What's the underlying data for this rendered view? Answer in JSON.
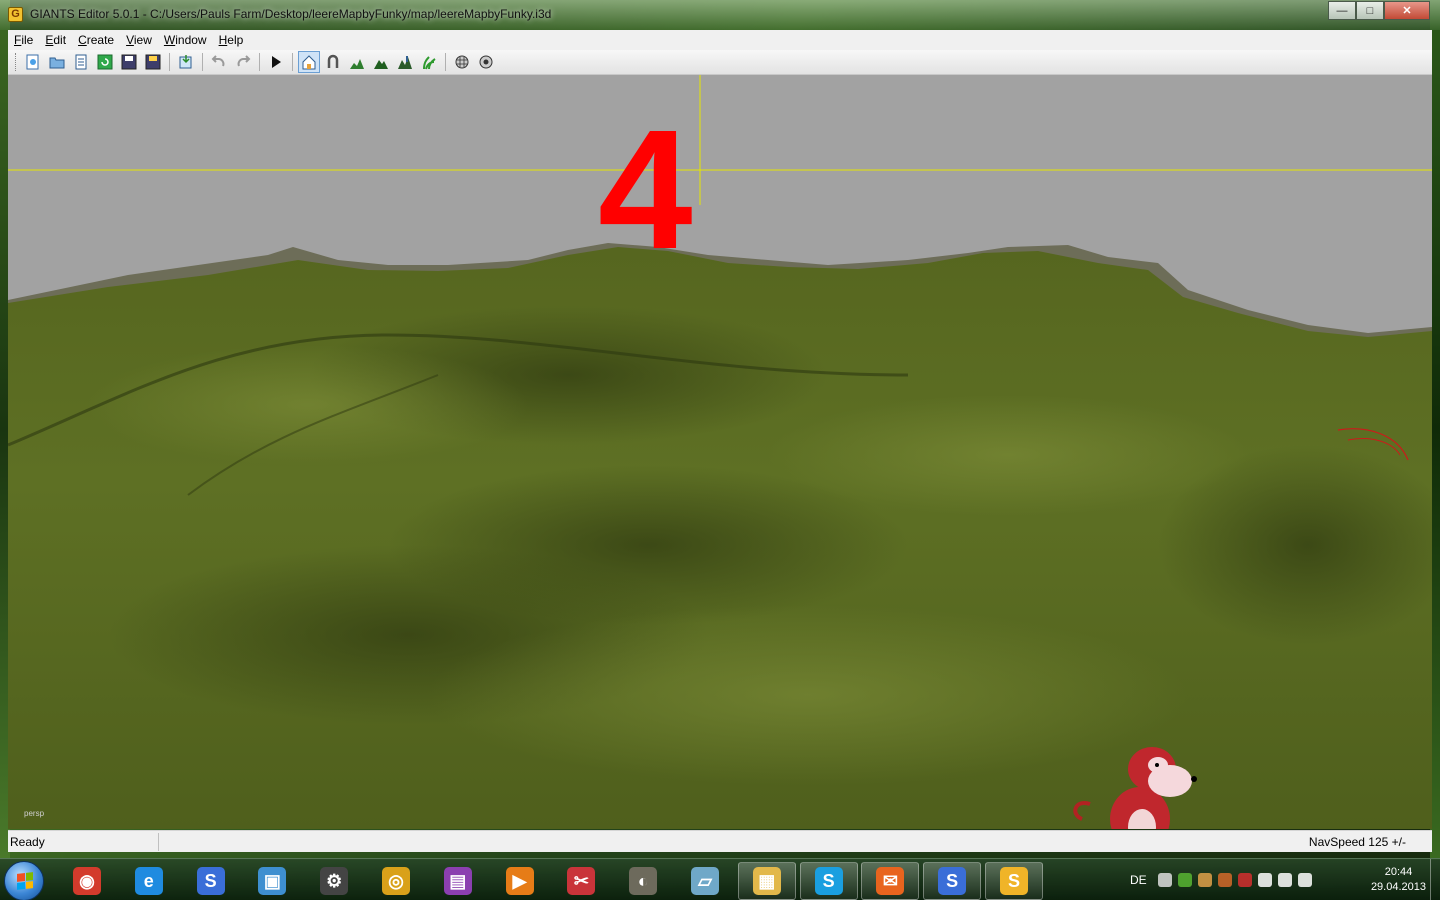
{
  "window": {
    "title": "GIANTS Editor 5.0.1 - C:/Users/Pauls Farm/Desktop/leereMapbyFunky/map/leereMapbyFunky.i3d",
    "app_icon_letter": "G",
    "minimize_glyph": "—",
    "maximize_glyph": "□",
    "close_glyph": "✕"
  },
  "menu": [
    {
      "first": "F",
      "rest": "ile"
    },
    {
      "first": "E",
      "rest": "dit"
    },
    {
      "first": "C",
      "rest": "reate"
    },
    {
      "first": "V",
      "rest": "iew"
    },
    {
      "first": "W",
      "rest": "indow"
    },
    {
      "first": "H",
      "rest": "elp"
    }
  ],
  "toolbar": {
    "icons": [
      "new-scene-icon",
      "open-icon",
      "document-icon",
      "refresh-icon",
      "save-icon",
      "save-as-icon",
      "import-icon",
      "undo-icon",
      "redo-icon",
      "play-icon",
      "select-icon",
      "move-icon",
      "terrain-sculpt-icon",
      "terrain-paint-icon",
      "terrain-foliage-icon",
      "foliage-paint-icon",
      "grid-icon",
      "snap-icon"
    ]
  },
  "viewport": {
    "overlay_number": "4",
    "camera_label": "persp",
    "sky_color": "#a2a2a2",
    "terrain_color": "#5a6b22",
    "crosshair_color": "#e6e600",
    "overlay_color": "#ff0000"
  },
  "statusbar": {
    "left": "Ready",
    "right": "NavSpeed 125 +/-"
  },
  "taskbar": {
    "apps": [
      {
        "name": "chrome-icon",
        "glyph": "◉",
        "color": "#d33b2c",
        "open": false
      },
      {
        "name": "internet-explorer-icon",
        "glyph": "e",
        "color": "#1f8be0",
        "open": false
      },
      {
        "name": "giants-editor-icon",
        "glyph": "S",
        "color": "#3a6ed8",
        "open": false
      },
      {
        "name": "computer-icon",
        "glyph": "▣",
        "color": "#3e8fd0",
        "open": false
      },
      {
        "name": "settings-gear-icon",
        "glyph": "⚙",
        "color": "#444444",
        "open": false
      },
      {
        "name": "disc-burner-icon",
        "glyph": "◎",
        "color": "#d9a11a",
        "open": false
      },
      {
        "name": "winrar-icon",
        "glyph": "▤",
        "color": "#8b3fb0",
        "open": false
      },
      {
        "name": "media-player-icon",
        "glyph": "▶",
        "color": "#e67c17",
        "open": false
      },
      {
        "name": "snipping-tool-icon",
        "glyph": "✂",
        "color": "#c9343a",
        "open": false
      },
      {
        "name": "gimp-icon",
        "glyph": "◐",
        "color": "#6d6a5c",
        "open": false
      },
      {
        "name": "notepad-icon",
        "glyph": "▱",
        "color": "#6fa8c8",
        "open": false
      },
      {
        "name": "file-explorer-icon",
        "glyph": "▦",
        "color": "#e2b84a",
        "open": true
      },
      {
        "name": "skype-icon",
        "glyph": "S",
        "color": "#1a9fe0",
        "open": true
      },
      {
        "name": "mail-icon",
        "glyph": "✉",
        "color": "#e8641e",
        "open": true
      },
      {
        "name": "giants-editor-2-icon",
        "glyph": "S",
        "color": "#3a6ed8",
        "open": true
      },
      {
        "name": "giants-editor-active-icon",
        "glyph": "S",
        "color": "#f0b428",
        "open": true
      }
    ],
    "language": "DE",
    "tray_icons": [
      {
        "name": "show-hidden-icon",
        "color": "#dddddd"
      },
      {
        "name": "evernote-icon",
        "color": "#58b533"
      },
      {
        "name": "touch-icon",
        "color": "#e0a14a"
      },
      {
        "name": "printer-icon",
        "color": "#d46a2a"
      },
      {
        "name": "antivirus-icon",
        "color": "#d32f2f"
      },
      {
        "name": "action-center-flag-icon",
        "color": "#ffffff"
      },
      {
        "name": "network-signal-icon",
        "color": "#ffffff"
      },
      {
        "name": "volume-icon",
        "color": "#ffffff"
      }
    ],
    "time": "20:44",
    "date": "29.04.2013"
  }
}
